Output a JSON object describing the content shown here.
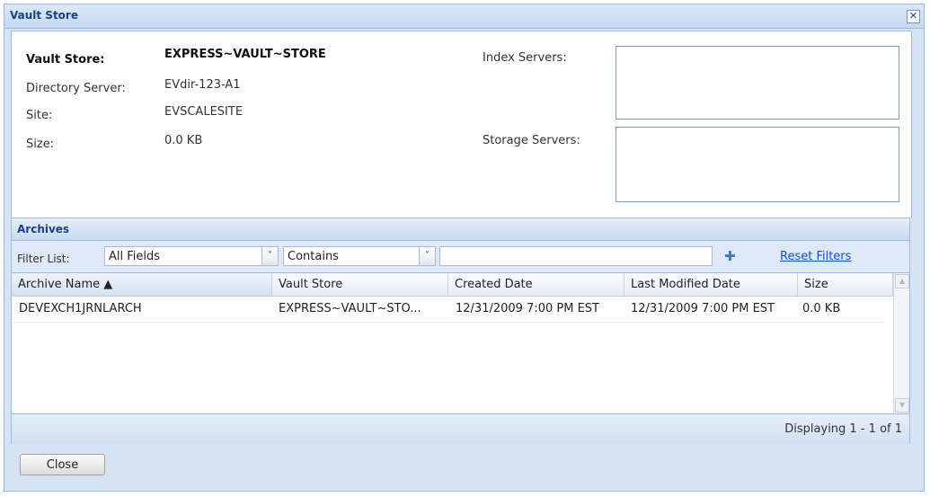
{
  "window": {
    "title": "Vault Store",
    "close_glyph": "✕"
  },
  "details": {
    "vault_store_label": "Vault Store:",
    "vault_store_value": "EXPRESS~VAULT~STORE",
    "directory_server_label": "Directory Server:",
    "directory_server_value": "EVdir-123-A1",
    "site_label": "Site:",
    "site_value": "EVSCALESITE",
    "size_label": "Size:",
    "size_value": "0.0 KB",
    "index_servers_label": "Index Servers:",
    "storage_servers_label": "Storage Servers:"
  },
  "archives": {
    "title": "Archives",
    "filter_label": "Filter List:",
    "field_select": "All Fields",
    "operator_select": "Contains",
    "filter_value": "",
    "add_filter_icon": "plus-icon",
    "reset_filters": "Reset Filters",
    "columns": [
      "Archive Name ▲",
      "Vault Store",
      "Created Date",
      "Last Modified Date",
      "Size"
    ],
    "rows": [
      [
        "DEVEXCH1JRNLARCH",
        "EXPRESS~VAULT~STO...",
        "12/31/2009 7:00 PM EST",
        "12/31/2009 7:00 PM EST",
        "0.0 KB"
      ]
    ],
    "paging_info": "Displaying 1 - 1 of 1"
  },
  "footer": {
    "close_label": "Close"
  }
}
